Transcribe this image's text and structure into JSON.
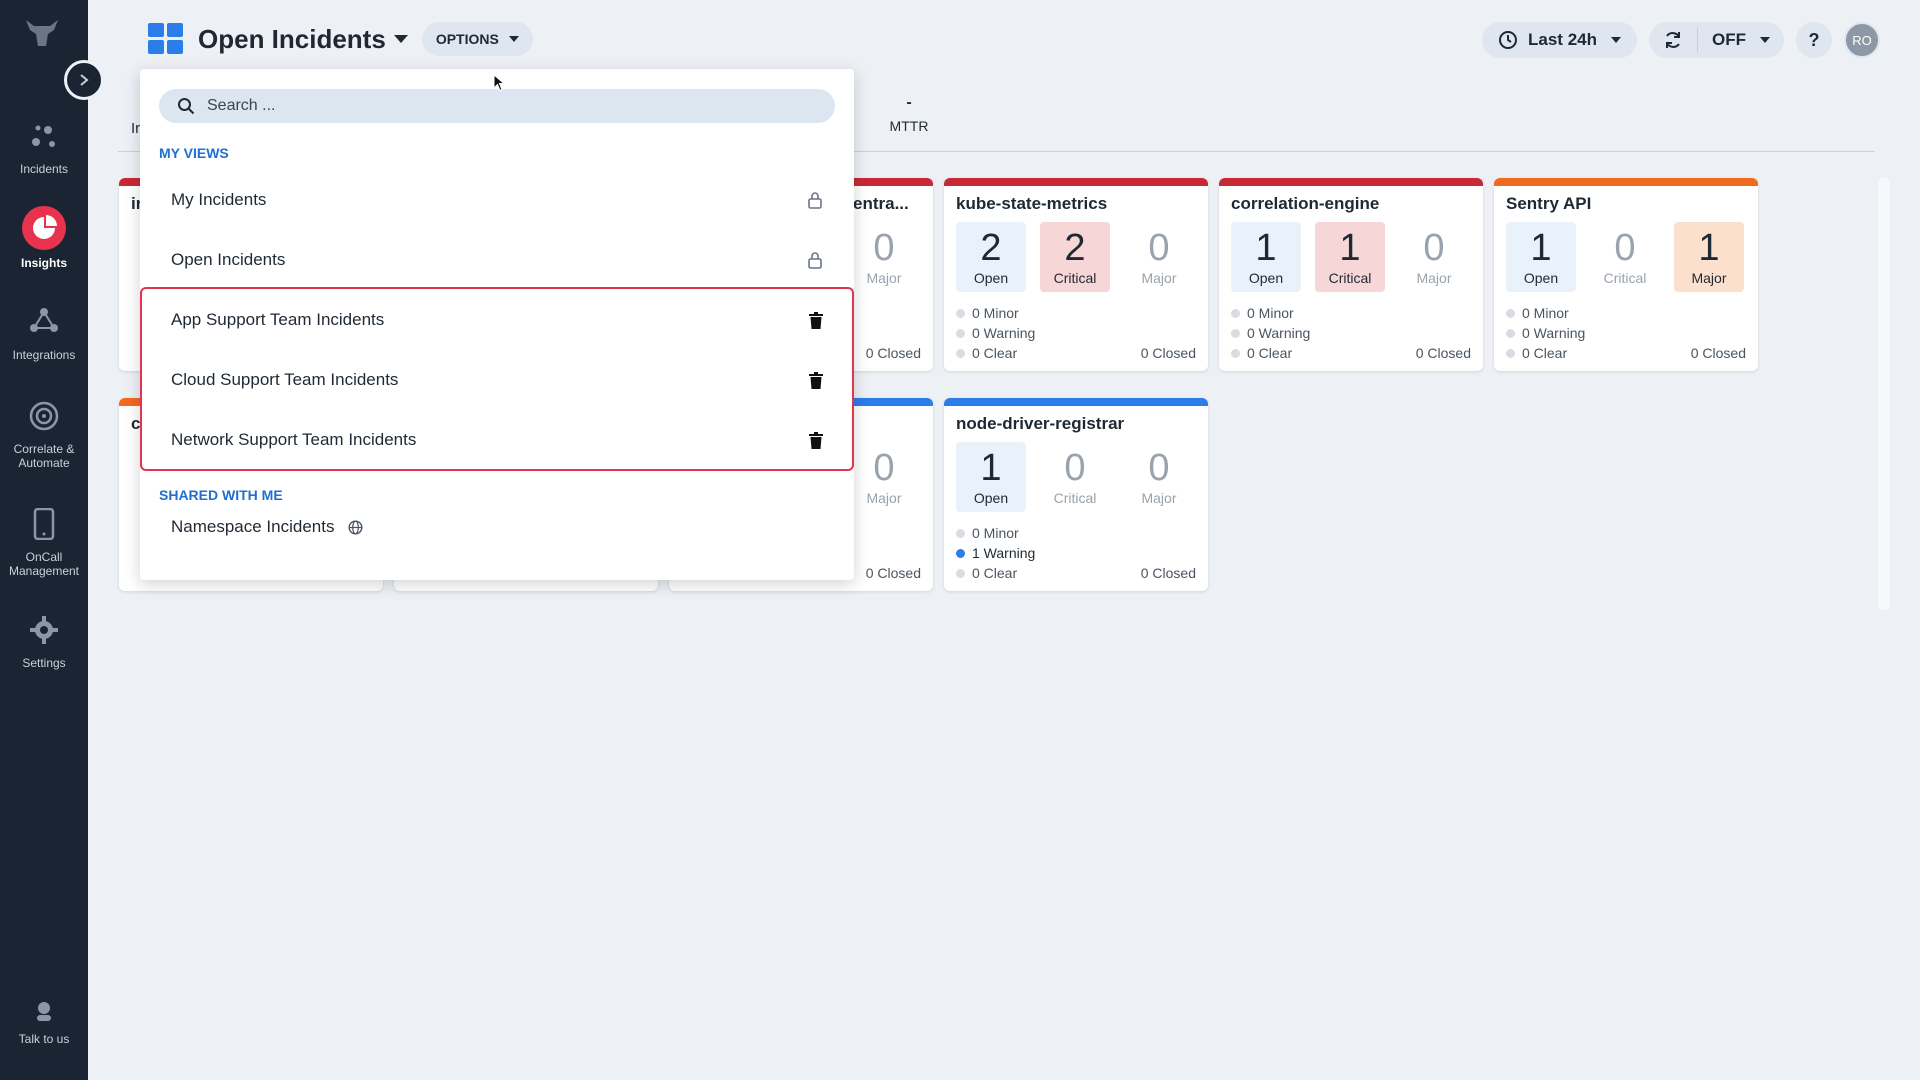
{
  "sidebar": {
    "items": [
      {
        "label": "Incidents"
      },
      {
        "label": "Insights"
      },
      {
        "label": "Integrations"
      },
      {
        "label": "Correlate &",
        "label2": "Automate"
      },
      {
        "label": "OnCall",
        "label2": "Management"
      },
      {
        "label": "Settings"
      }
    ],
    "footer": {
      "label": "Talk to us"
    }
  },
  "header": {
    "title": "Open Incidents",
    "options_label": "OPTIONS",
    "time_range": "Last 24h",
    "refresh_state": "OFF",
    "help_label": "?",
    "avatar_initials": "RO"
  },
  "stats": {
    "partial_tab": "Ir",
    "mttr_value": "-",
    "mttr_label": "MTTR"
  },
  "cards": [
    {
      "name": "kube-state-metrics",
      "bar_color": "#c62a36",
      "open": "2",
      "open_label": "Open",
      "critical": "2",
      "critical_label": "Critical",
      "major": "0",
      "major_label": "Major",
      "minor": "0 Minor",
      "warning": "0 Warning",
      "clear": "0 Clear",
      "closed": "0 Closed"
    },
    {
      "name": "correlation-engine",
      "bar_color": "#c62a36",
      "open": "1",
      "open_label": "Open",
      "critical": "1",
      "critical_label": "Critical",
      "major": "0",
      "major_label": "Major",
      "minor": "0 Minor",
      "warning": "0 Warning",
      "clear": "0 Clear",
      "closed": "0 Closed"
    },
    {
      "name": "Sentry API",
      "bar_color": "#f06b1f",
      "open": "1",
      "open_label": "Open",
      "critical": "0",
      "critical_label": "Critical",
      "major": "1",
      "major_label": "Major",
      "minor": "0 Minor",
      "warning": "0 Warning",
      "clear": "0 Clear",
      "closed": "0 Closed"
    },
    {
      "name": "node-driver-registrar",
      "bar_color": "#2b7de9",
      "open": "1",
      "open_label": "Open",
      "critical": "0",
      "critical_label": "Critical",
      "major": "0",
      "major_label": "Major",
      "minor": "0 Minor",
      "warning": "1 Warning",
      "clear": "0 Clear",
      "closed": "0 Closed"
    }
  ],
  "partial_cards": [
    {
      "name": "entra...",
      "major": "0",
      "major_label": "Major",
      "closed": "0 Closed"
    },
    {
      "major": "0",
      "major_label": "Major",
      "closed": "0 Closed"
    },
    {
      "letter_top": "ir",
      "letter_bottom": "c"
    }
  ],
  "dropdown": {
    "search_placeholder": "Search ...",
    "my_views_title": "MY VIEWS",
    "my_views": [
      {
        "label": "My Incidents",
        "icon": "lock-icon"
      },
      {
        "label": "Open Incidents",
        "icon": "lock-icon"
      },
      {
        "label": "App Support Team Incidents",
        "icon": "trash-icon"
      },
      {
        "label": "Cloud Support Team Incidents",
        "icon": "trash-icon"
      },
      {
        "label": "Network Support Team Incidents",
        "icon": "trash-icon"
      }
    ],
    "shared_title": "SHARED WITH ME",
    "shared": [
      {
        "label": "Namespace Incidents",
        "icon": "globe-icon"
      }
    ]
  },
  "colors": {
    "accent": "#2b7de9",
    "brand_active": "#e8334f",
    "critical": "#c62a36",
    "major": "#f06b1f",
    "sidebar_bg": "#1b2433"
  }
}
